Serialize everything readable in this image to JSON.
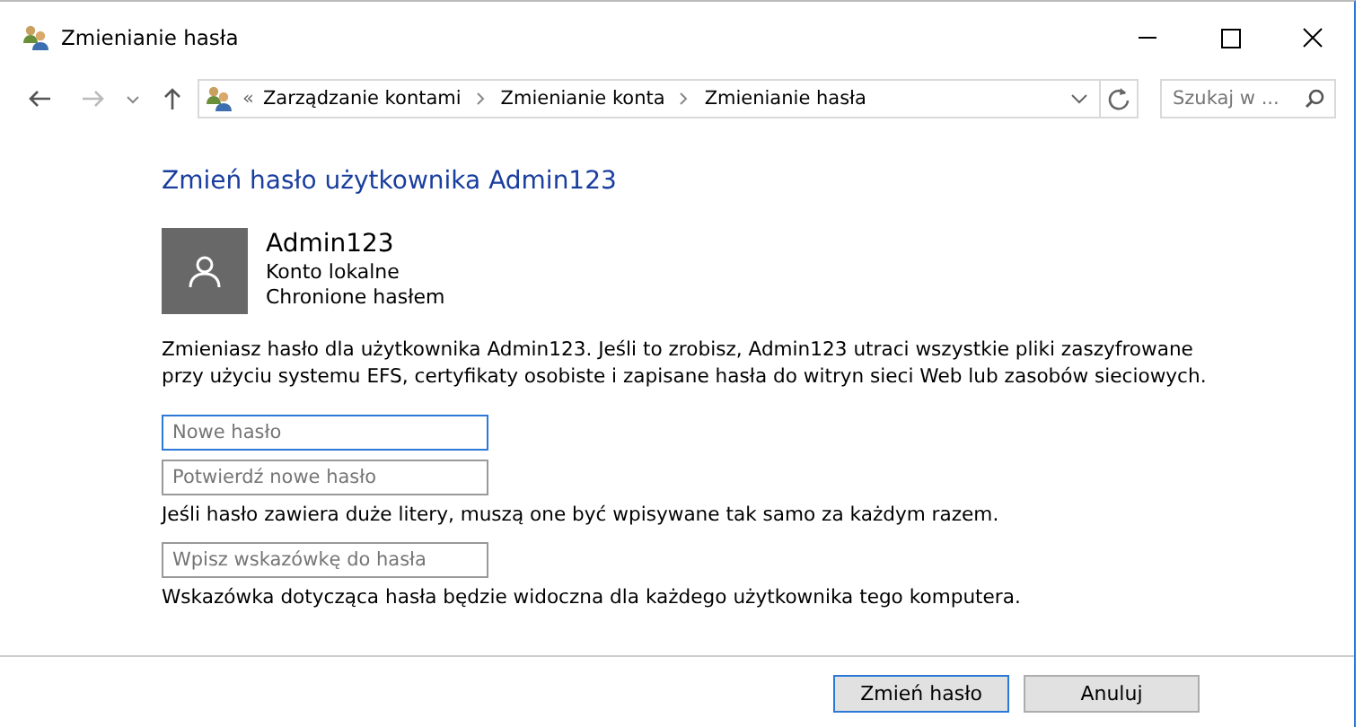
{
  "window": {
    "title": "Zmienianie hasła"
  },
  "address_bar": {
    "overflow": "«",
    "breadcrumbs": [
      "Zarządzanie kontami",
      "Zmienianie konta",
      "Zmienianie hasła"
    ]
  },
  "search": {
    "placeholder": "Szukaj w ..."
  },
  "heading": "Zmień hasło użytkownika Admin123",
  "account": {
    "name": "Admin123",
    "type": "Konto lokalne",
    "protection": "Chronione hasłem"
  },
  "warning": "Zmieniasz hasło dla użytkownika Admin123. Jeśli to zrobisz, Admin123 utraci wszystkie pliki zaszyfrowane przy użyciu systemu EFS, certyfikaty osobiste i zapisane hasła do witryn sieci Web lub zasobów sieciowych.",
  "fields": [
    {
      "kind": "field",
      "placeholder": "Nowe hasło",
      "focused": true
    },
    {
      "kind": "field",
      "placeholder": "Potwierdź nowe hasło",
      "focused": false
    },
    {
      "kind": "note",
      "text": "Jeśli hasło zawiera duże litery, muszą one być wpisywane tak samo za każdym razem."
    },
    {
      "kind": "field",
      "placeholder": "Wpisz wskazówkę do hasła",
      "focused": false
    },
    {
      "kind": "note",
      "text": "Wskazówka dotycząca hasła będzie widoczna dla każdego użytkownika tego komputera."
    }
  ],
  "buttons": [
    {
      "label": "Zmień hasło",
      "default": true
    },
    {
      "label": "Anuluj",
      "default": false
    }
  ]
}
